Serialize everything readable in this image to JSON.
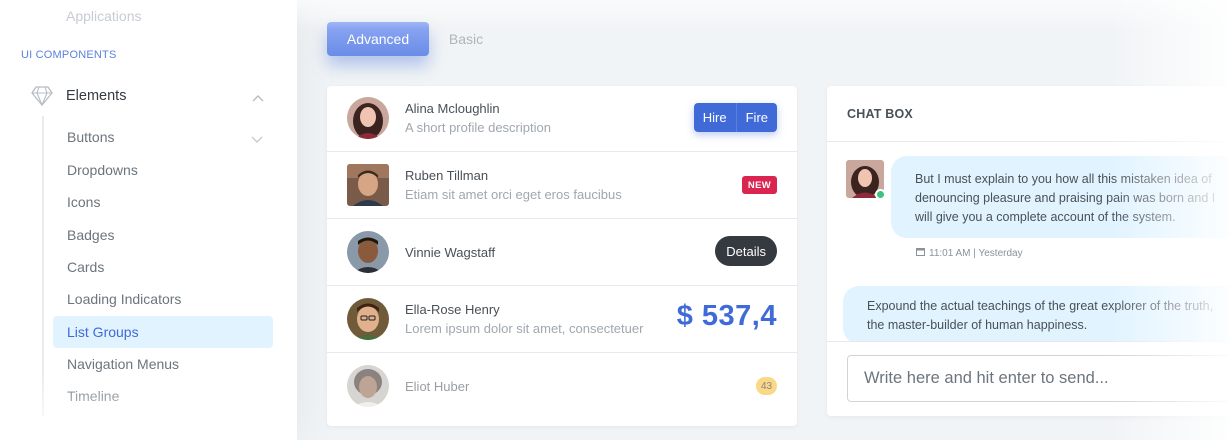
{
  "sidebar": {
    "faded_top": "Applications",
    "section_title": "UI COMPONENTS",
    "parent_label": "Elements",
    "items": [
      {
        "label": "Buttons"
      },
      {
        "label": "Dropdowns"
      },
      {
        "label": "Icons"
      },
      {
        "label": "Badges"
      },
      {
        "label": "Cards"
      },
      {
        "label": "Loading Indicators"
      },
      {
        "label": "List Groups"
      },
      {
        "label": "Navigation Menus"
      },
      {
        "label": "Timeline"
      }
    ],
    "active_item": "List Groups"
  },
  "tabs": {
    "advanced": "Advanced",
    "basic": "Basic",
    "selected": "Advanced"
  },
  "list": {
    "items": [
      {
        "name": "Alina Mcloughlin",
        "desc": "A short profile description",
        "actions": [
          "Hire",
          "Fire"
        ]
      },
      {
        "name": "Ruben Tillman",
        "desc": "Etiam sit amet orci eget eros faucibus",
        "badge": "NEW"
      },
      {
        "name": "Vinnie Wagstaff",
        "button": "Details"
      },
      {
        "name": "Ella-Rose Henry",
        "desc": "Lorem ipsum dolor sit amet, consectetuer",
        "amount": "$ 537,4"
      },
      {
        "name": "Eliot Huber",
        "count": "43"
      }
    ]
  },
  "chat": {
    "title": "CHAT BOX",
    "message1": "But I must explain to you how all this mistaken idea of denouncing pleasure and praising pain was born and I will give you a complete account of the system.",
    "message1_time": "11:01 AM | Yesterday",
    "message2": "Expound the actual teachings of the great explorer of the truth, the master-builder of human happiness.",
    "input_placeholder": "Write here and hit enter to send..."
  },
  "colors": {
    "primary": "#3f6ad8",
    "danger": "#d92550",
    "warning": "#f7b924",
    "dark": "#343a40",
    "success": "#3ac47d",
    "active_bg": "#e0f3ff"
  }
}
